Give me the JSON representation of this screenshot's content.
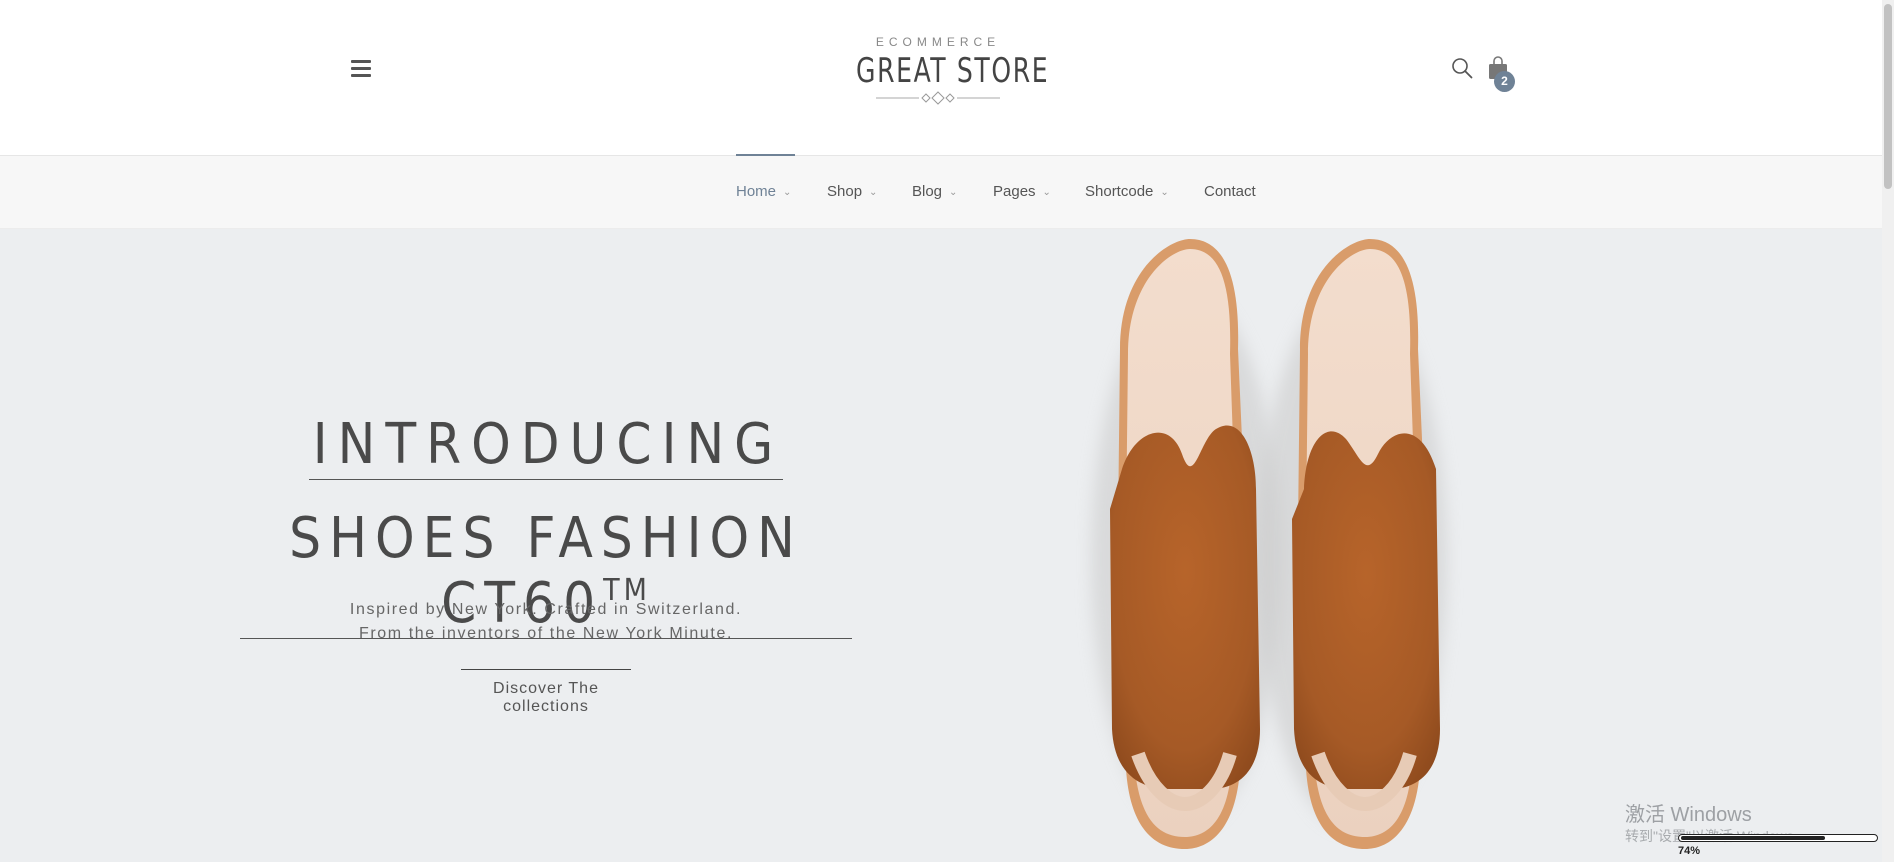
{
  "header": {
    "menu_icon": "hamburger-icon",
    "logo_small": "ECOMMERCE",
    "logo_main": "GREAT STORE",
    "search_icon": "search-icon",
    "cart_icon": "shopping-bag-icon",
    "cart_count": "2"
  },
  "nav": {
    "items": [
      {
        "label": "Home",
        "has_dropdown": true,
        "active": true
      },
      {
        "label": "Shop",
        "has_dropdown": true
      },
      {
        "label": "Blog",
        "has_dropdown": true
      },
      {
        "label": "Pages",
        "has_dropdown": true
      },
      {
        "label": "Shortcode",
        "has_dropdown": true
      },
      {
        "label": "Contact",
        "has_dropdown": false
      }
    ],
    "chevron": "⌄",
    "accent_color": "#6f8296"
  },
  "hero": {
    "title_line1": "INTRODUCING",
    "title_line2": "SHOES FASHION CT60",
    "title_tm": "TM",
    "subtitle_line1": "Inspired by New York. Crafted in Switzerland.",
    "subtitle_line2": "From the inventors of the New York Minute.",
    "cta_label": "Discover The collections",
    "background": "#eceef0"
  },
  "overlay": {
    "watermark_title": "激活 Windows",
    "watermark_sub": "转到\"设置\"以激活 Windows。",
    "zoom_label": "74%",
    "zoom_level": 0.74
  }
}
